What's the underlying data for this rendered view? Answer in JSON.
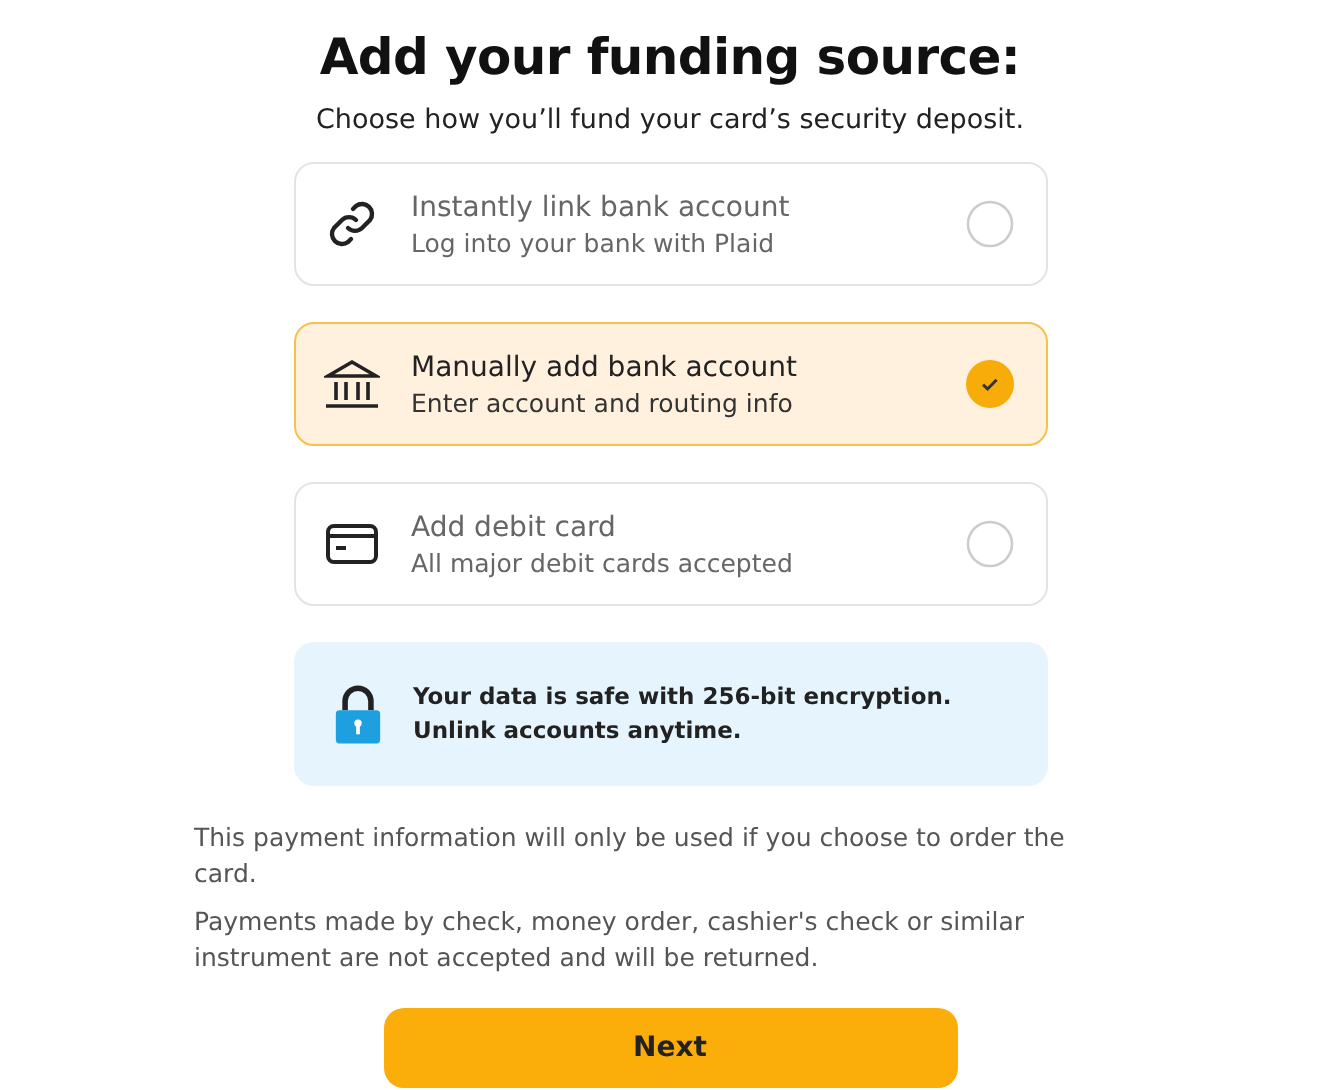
{
  "title": "Add your funding source:",
  "subtitle": "Choose how you’ll fund your card’s security deposit.",
  "options": [
    {
      "kind": "link",
      "title": "Instantly link bank account",
      "description": "Log into your bank with Plaid",
      "selected": false
    },
    {
      "kind": "bank",
      "title": "Manually add bank account",
      "description": "Enter account and routing info",
      "selected": true
    },
    {
      "kind": "card",
      "title": "Add debit card",
      "description": "All major debit cards accepted",
      "selected": false
    }
  ],
  "security_note": "Your data is safe with 256-bit encryption. Unlink accounts anytime.",
  "disclaimers": [
    "This payment information will only be used if you choose to order the card.",
    "Payments made by check, money order, cashier's check or similar instrument are not accepted and will be returned."
  ],
  "next_button": "Next"
}
